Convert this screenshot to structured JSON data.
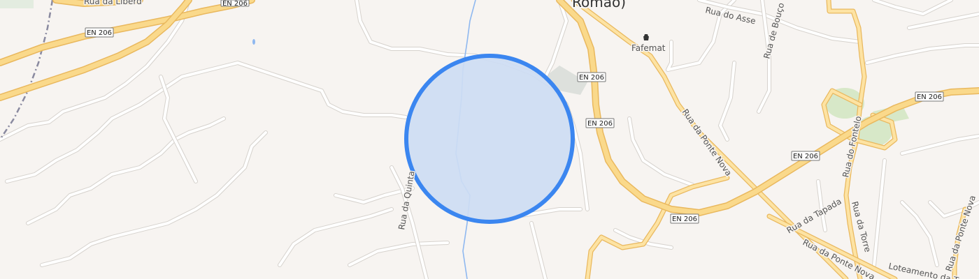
{
  "map": {
    "place_label": "Romão)",
    "poi": {
      "name": "Fafemat",
      "icon": "shopping-basket-icon"
    },
    "route_shields": [
      "EN 206",
      "EN 206",
      "EN 206",
      "EN 206",
      "EN 206",
      "EN 206"
    ],
    "streets": {
      "rua_da_liberdade": "Rua da Liberd",
      "rua_do_asse": "Rua do Asse",
      "rua_de_bouco": "Rua de Bouço",
      "rua_da_ponte_nova_1": "Rua da Ponte Nova",
      "rua_da_ponte_nova_2": "Rua da Ponte Nova",
      "rua_da_ponte_nova_3": "Rua da Ponte Nova",
      "rua_do_fontelo": "Rua do Fontelo",
      "rua_da_tapada": "Rua da Tapada",
      "rua_da_torre": "Rua da Torre",
      "rua_da_quinta": "Rua da Quinta",
      "loteamento": "Loteamento da Torre"
    },
    "colors": {
      "background": "#f7f4f1",
      "major_road": "#fad98b",
      "major_road_casing": "#e9b85e",
      "minor_road": "#ffffff",
      "water": "#8fb8f0",
      "green": "#d7e8c8",
      "selection_fill": "#cddcf3",
      "selection_stroke": "#3b86f0",
      "railway": "#8a8aa0"
    }
  }
}
